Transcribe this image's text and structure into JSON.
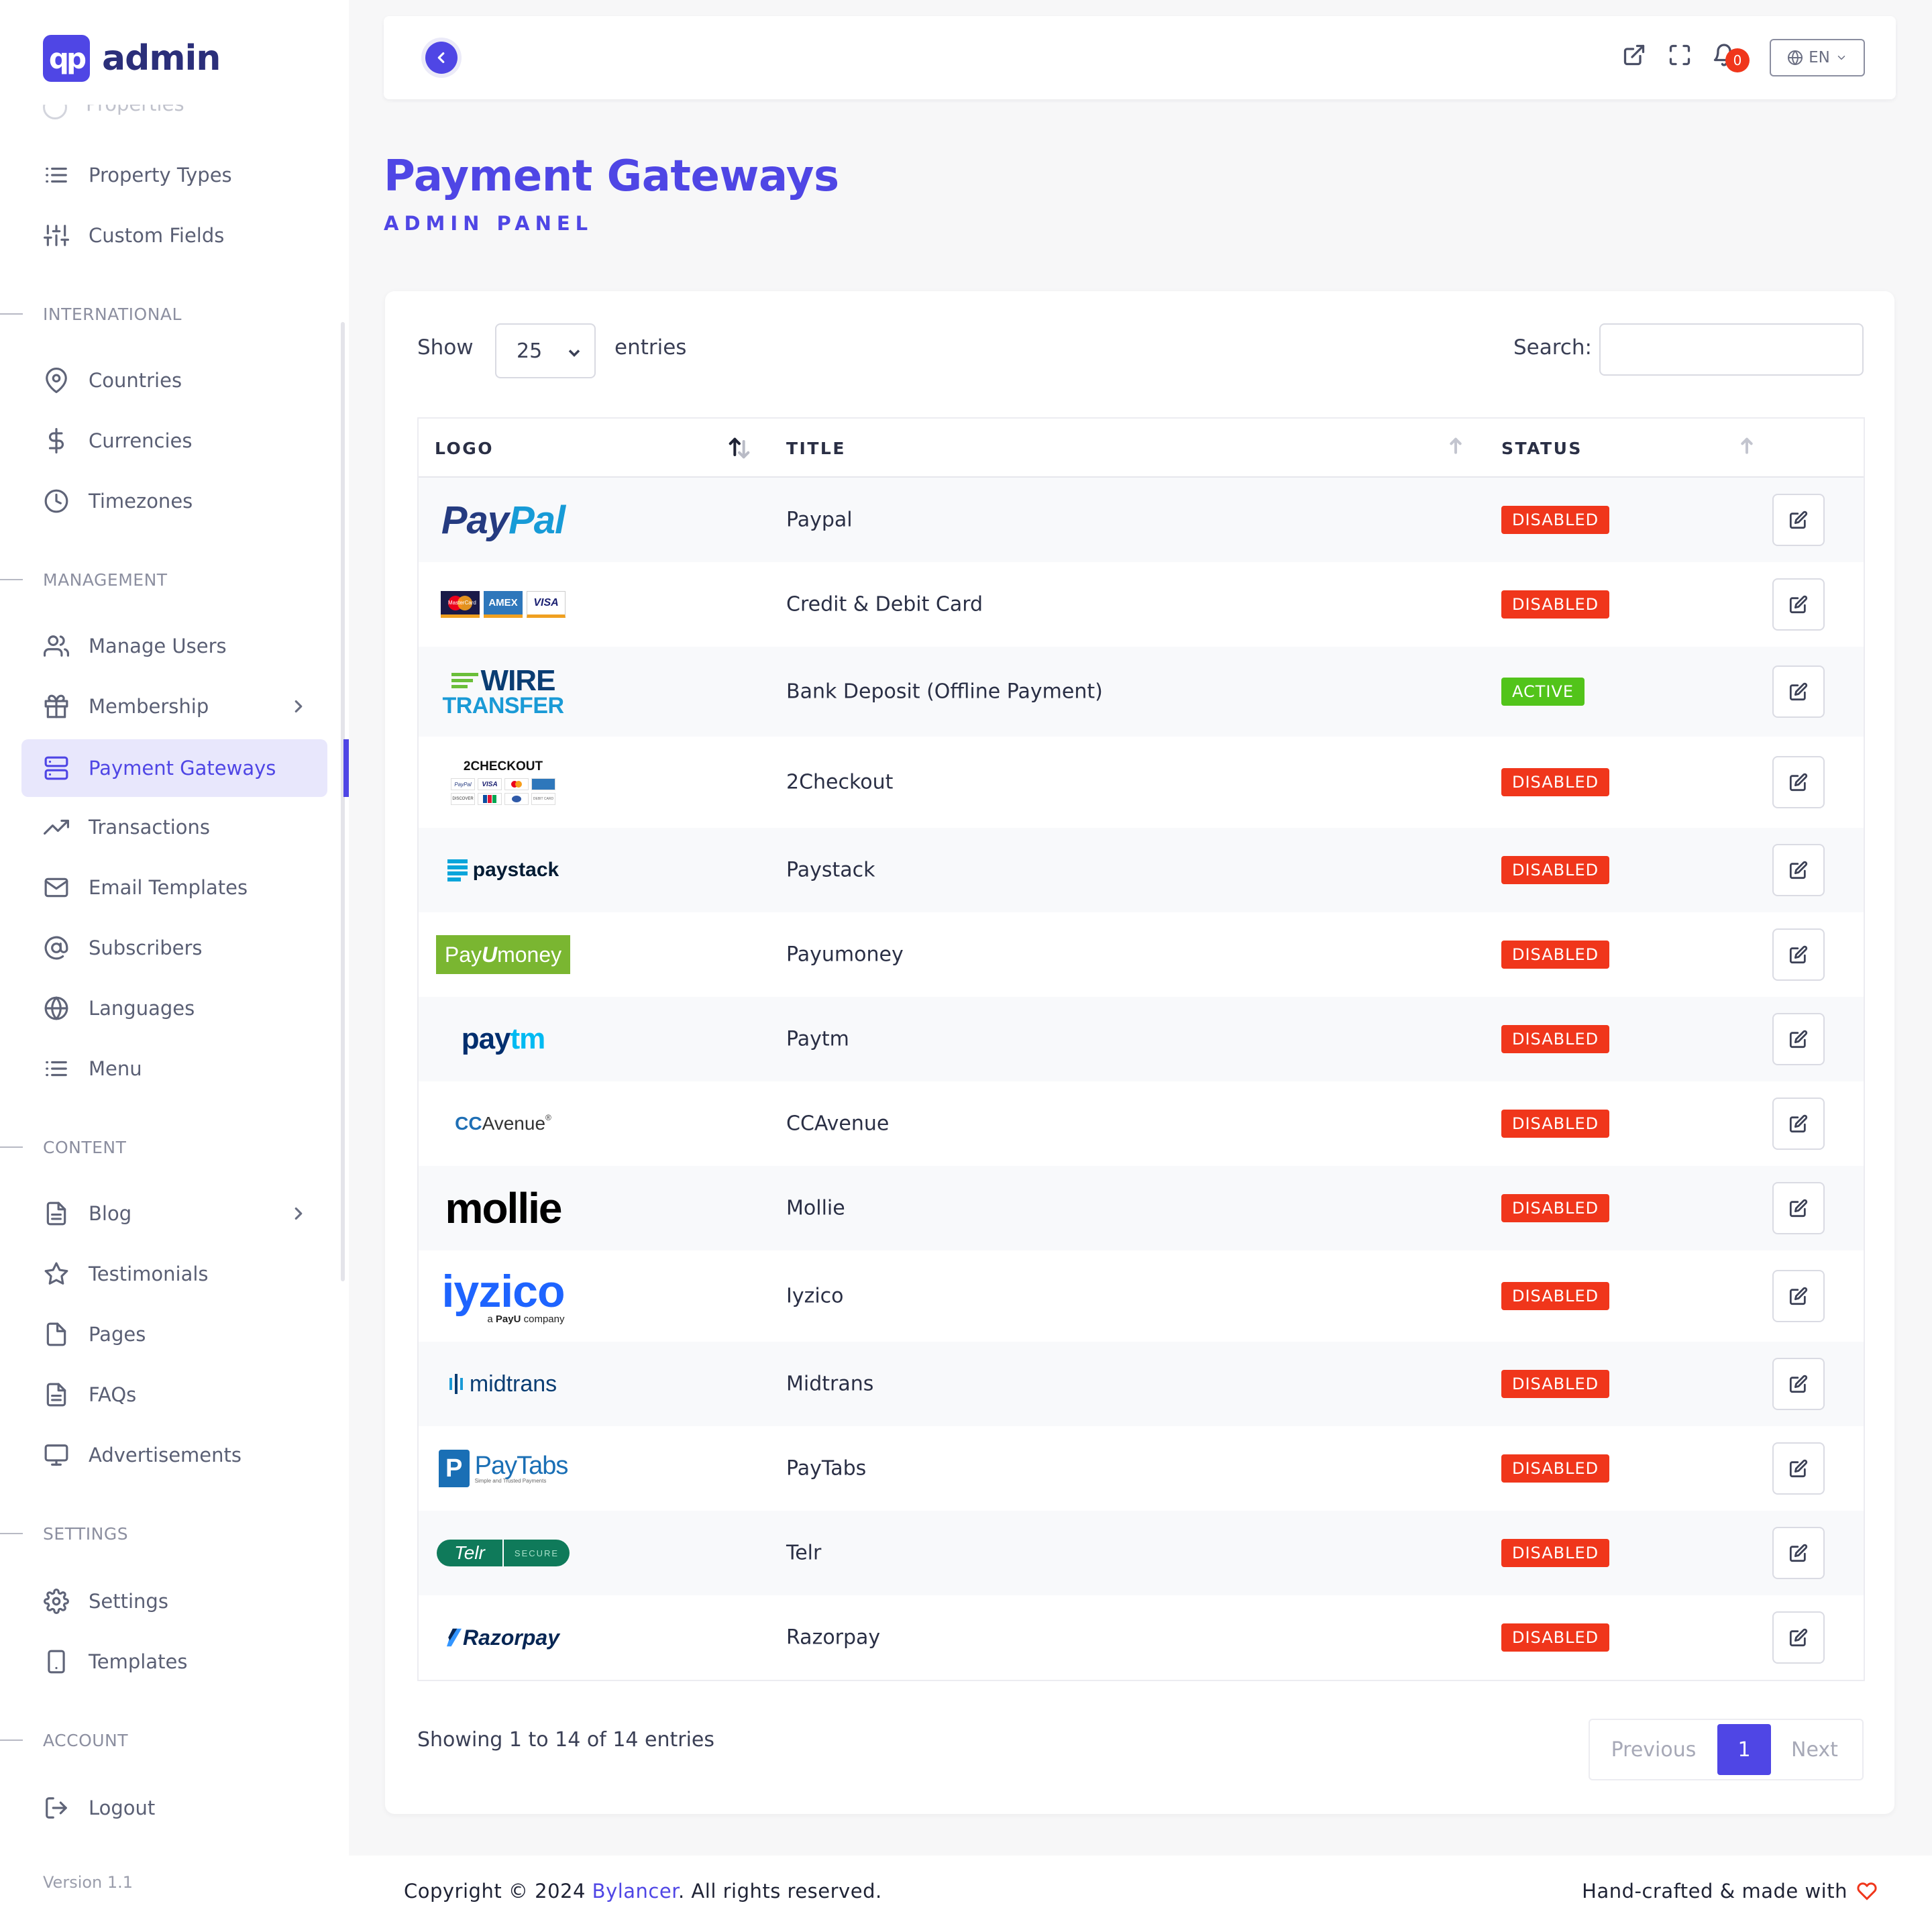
{
  "brand": {
    "logo_text": "qp",
    "name": "admin"
  },
  "sidebar": {
    "ghost_item": "Properties",
    "items_top": [
      {
        "label": "Property Types",
        "icon": "list-icon"
      },
      {
        "label": "Custom Fields",
        "icon": "sliders-icon"
      }
    ],
    "sections": {
      "international": "INTERNATIONAL",
      "management": "MANAGEMENT",
      "content": "CONTENT",
      "settings": "SETTINGS",
      "account": "ACCOUNT"
    },
    "international": [
      {
        "label": "Countries",
        "icon": "map-pin-icon"
      },
      {
        "label": "Currencies",
        "icon": "dollar-icon"
      },
      {
        "label": "Timezones",
        "icon": "clock-icon"
      }
    ],
    "management": [
      {
        "label": "Manage Users",
        "icon": "users-icon"
      },
      {
        "label": "Membership",
        "icon": "gift-icon"
      },
      {
        "label": "Payment Gateways",
        "icon": "server-icon"
      },
      {
        "label": "Transactions",
        "icon": "trending-up-icon"
      },
      {
        "label": "Email Templates",
        "icon": "mail-icon"
      },
      {
        "label": "Subscribers",
        "icon": "at-sign-icon"
      },
      {
        "label": "Languages",
        "icon": "globe-icon"
      },
      {
        "label": "Menu",
        "icon": "list-icon"
      }
    ],
    "content": [
      {
        "label": "Blog",
        "icon": "file-text-icon"
      },
      {
        "label": "Testimonials",
        "icon": "star-icon"
      },
      {
        "label": "Pages",
        "icon": "file-icon"
      },
      {
        "label": "FAQs",
        "icon": "file-text-icon"
      },
      {
        "label": "Advertisements",
        "icon": "monitor-icon"
      }
    ],
    "settings": [
      {
        "label": "Settings",
        "icon": "gear-icon"
      },
      {
        "label": "Templates",
        "icon": "tablet-icon"
      }
    ],
    "account": [
      {
        "label": "Logout",
        "icon": "logout-icon"
      }
    ],
    "active_item": "Payment Gateways",
    "version": "Version 1.1"
  },
  "topbar": {
    "notification_count": "0",
    "language": "EN"
  },
  "page": {
    "title": "Payment Gateways",
    "subtitle": "ADMIN PANEL"
  },
  "table_controls": {
    "show_label": "Show",
    "entries_value": "25",
    "entries_label": "entries",
    "search_label": "Search:",
    "search_value": ""
  },
  "table": {
    "columns": [
      "LOGO",
      "TITLE",
      "STATUS"
    ],
    "rows": [
      {
        "logo": "PayPal",
        "title": "Paypal",
        "status": "DISABLED"
      },
      {
        "logo": "Cards",
        "title": "Credit & Debit Card",
        "status": "DISABLED"
      },
      {
        "logo": "Wire Transfer",
        "title": "Bank Deposit (Offline Payment)",
        "status": "ACTIVE"
      },
      {
        "logo": "2Checkout",
        "title": "2Checkout",
        "status": "DISABLED"
      },
      {
        "logo": "paystack",
        "title": "Paystack",
        "status": "DISABLED"
      },
      {
        "logo": "PayUmoney",
        "title": "Payumoney",
        "status": "DISABLED"
      },
      {
        "logo": "Paytm",
        "title": "Paytm",
        "status": "DISABLED"
      },
      {
        "logo": "CCAvenue",
        "title": "CCAvenue",
        "status": "DISABLED"
      },
      {
        "logo": "mollie",
        "title": "Mollie",
        "status": "DISABLED"
      },
      {
        "logo": "iyzico",
        "title": "Iyzico",
        "status": "DISABLED"
      },
      {
        "logo": "midtrans",
        "title": "Midtrans",
        "status": "DISABLED"
      },
      {
        "logo": "PayTabs",
        "title": "PayTabs",
        "status": "DISABLED"
      },
      {
        "logo": "Telr",
        "title": "Telr",
        "status": "DISABLED"
      },
      {
        "logo": "Razorpay",
        "title": "Razorpay",
        "status": "DISABLED"
      }
    ]
  },
  "logos": {
    "paypal_a": "Pay",
    "paypal_b": "Pal",
    "card_mc": "MasterCard",
    "card_amex": "AMEX",
    "card_visa": "VISA",
    "wire_a": "WIRE",
    "wire_b": "TRANSFER",
    "twoco_head": "2CHECKOUT",
    "twoco_paypal": "PayPal",
    "twoco_visa": "VISA",
    "twoco_discover": "DISCOVER",
    "twoco_debit": "DEBIT CARD",
    "paystack": "paystack",
    "payu_a": "Pay",
    "payu_u": "U",
    "payu_b": "money",
    "paytm_a": "pay",
    "paytm_b": "tm",
    "ccavenue_a": "CC",
    "ccavenue_b": "Avenue",
    "ccavenue_reg": "®",
    "mollie": "mollie",
    "iyzico": "iyzico",
    "iyzico_tag_a": "a ",
    "iyzico_tag_b": "PayU",
    "iyzico_tag_c": " company",
    "midtrans": "midtrans",
    "paytabs": "PayTabs",
    "paytabs_tag": "Simple and Trusted Payments",
    "telr": "Telr",
    "telr_secure": "SECURE",
    "razorpay": "Razorpay"
  },
  "footer": {
    "showing": "Showing 1 to 14 of 14 entries",
    "prev": "Previous",
    "current": "1",
    "next": "Next",
    "copyright_pre": "Copyright © 2024 ",
    "copyright_link": "Bylancer",
    "copyright_post": ". All rights reserved.",
    "made_with": "Hand-crafted & made with"
  },
  "colors": {
    "accent": "#4f46e5",
    "disabled": "#f0361b",
    "active": "#52c41a"
  }
}
